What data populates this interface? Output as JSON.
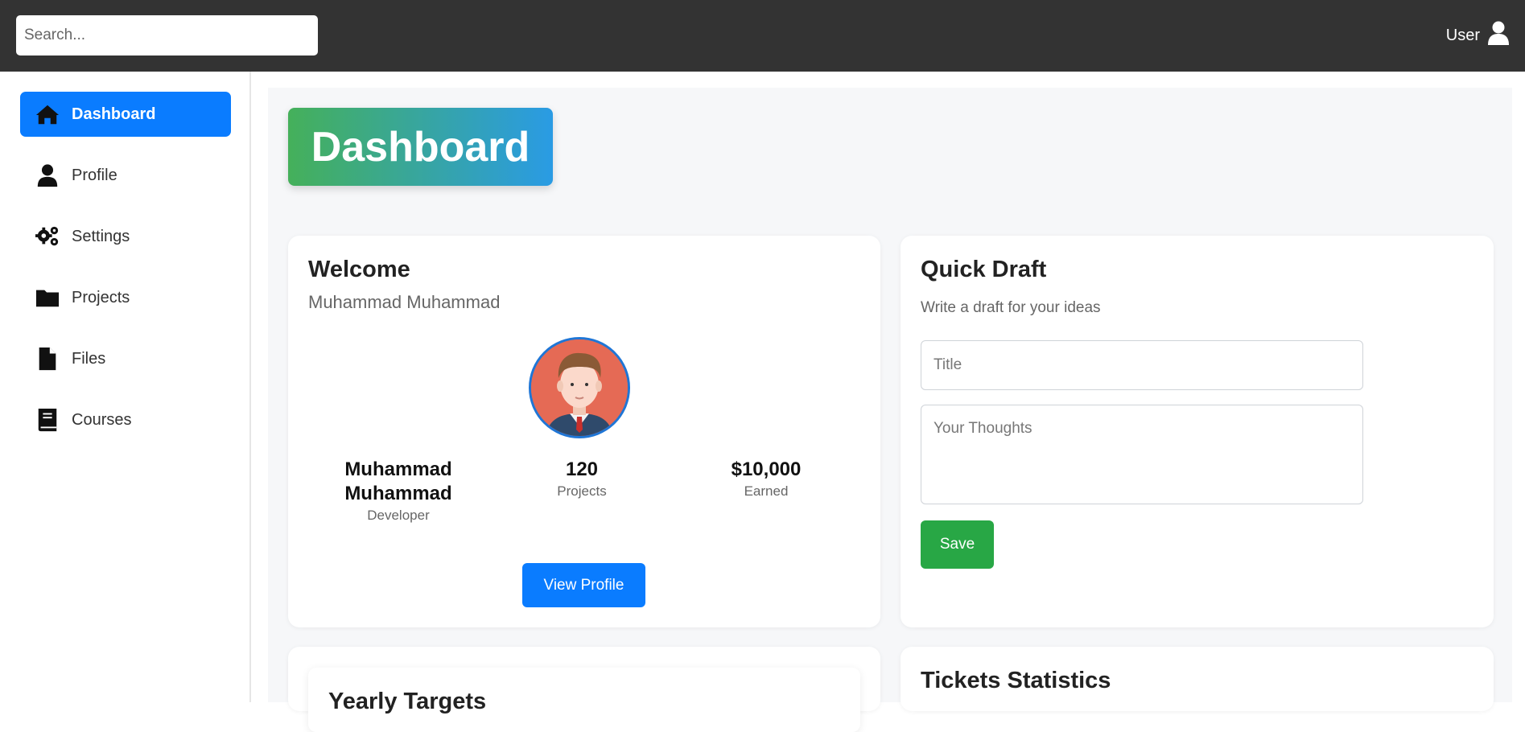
{
  "search": {
    "placeholder": "Search..."
  },
  "user": {
    "label": "User",
    "icon": "user-icon"
  },
  "sidebar": {
    "items": [
      {
        "label": "Dashboard",
        "icon": "home-icon",
        "active": true
      },
      {
        "label": "Profile",
        "icon": "user-icon",
        "active": false
      },
      {
        "label": "Settings",
        "icon": "gears-icon",
        "active": false
      },
      {
        "label": "Projects",
        "icon": "folder-icon",
        "active": false
      },
      {
        "label": "Files",
        "icon": "file-icon",
        "active": false
      },
      {
        "label": "Courses",
        "icon": "book-icon",
        "active": false
      }
    ]
  },
  "page": {
    "title": "Dashboard"
  },
  "welcome": {
    "heading": "Welcome",
    "name": "Muhammad Muhammad",
    "stats": [
      {
        "value": "Muhammad Muhammad",
        "label": "Developer"
      },
      {
        "value": "120",
        "label": "Projects"
      },
      {
        "value": "$10,000",
        "label": "Earned"
      }
    ],
    "button": "View Profile"
  },
  "draft": {
    "heading": "Quick Draft",
    "subtitle": "Write a draft for your ideas",
    "title_placeholder": "Title",
    "thoughts_placeholder": "Your Thoughts",
    "save_label": "Save"
  },
  "yearly": {
    "heading": "Yearly Targets"
  },
  "tickets": {
    "heading": "Tickets Statistics"
  },
  "colors": {
    "topbar": "#333333",
    "accent": "#0a7cff",
    "save": "#28a745",
    "badge_start": "#45b05a",
    "badge_end": "#2a9be4"
  }
}
